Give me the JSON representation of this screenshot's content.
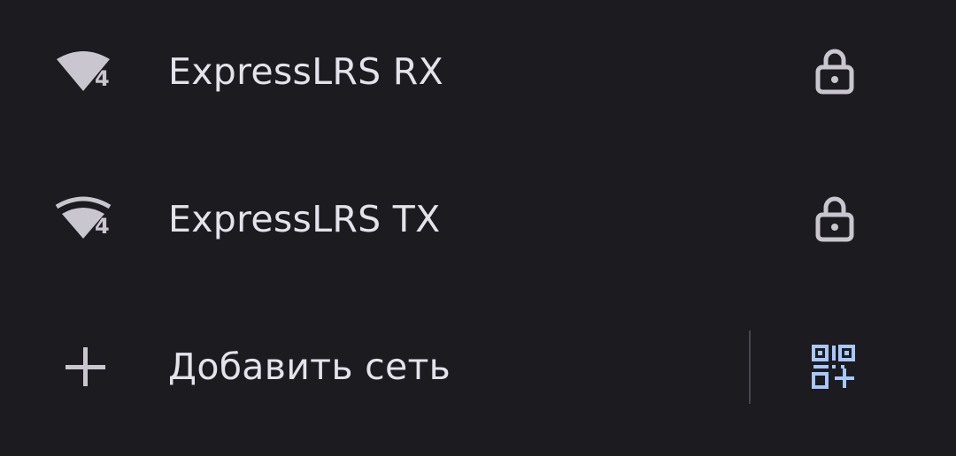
{
  "networks": [
    {
      "ssid": "ExpressLRS RX",
      "signal_icon": "wifi-4-full-icon",
      "generation": "4",
      "secured_icon": "lock-icon"
    },
    {
      "ssid": "ExpressLRS TX",
      "signal_icon": "wifi-4-partial-icon",
      "generation": "4",
      "secured_icon": "lock-icon"
    }
  ],
  "add_network": {
    "label": "Добавить сеть",
    "icon": "plus-icon",
    "qr_icon": "qr-code-scan-icon"
  },
  "colors": {
    "background": "#1b1b20",
    "text": "#e4e2ea",
    "icon": "#c9c6d0",
    "accent": "#a8c7fa",
    "divider": "#45454c"
  }
}
